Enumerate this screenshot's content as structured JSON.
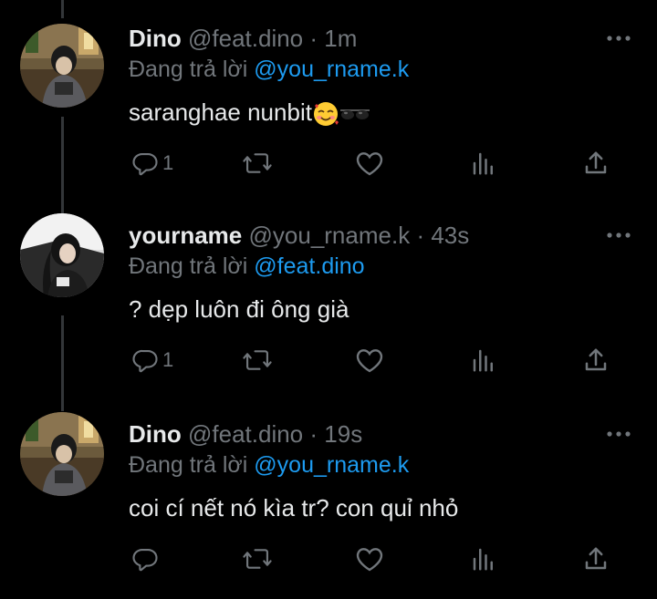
{
  "colors": {
    "background": "#000000",
    "text_primary": "#e7e9ea",
    "text_secondary": "#71767b",
    "link": "#1d9bf0",
    "thread_line": "#333639"
  },
  "tweets": [
    {
      "display_name": "Dino",
      "handle": "@feat.dino",
      "separator": "·",
      "time": "1m",
      "reply_prefix": "Đang trả lời",
      "reply_to": "@you_rname.k",
      "text": "saranghae nunbit",
      "emojis": [
        "smiling-face-with-hearts-emoji",
        "sunglasses-emoji"
      ],
      "reply_count": "1",
      "icons": [
        "reply-icon",
        "retweet-icon",
        "like-icon",
        "views-icon",
        "share-icon",
        "more-icon"
      ]
    },
    {
      "display_name": "yourname",
      "handle": "@you_rname.k",
      "separator": "·",
      "time": "43s",
      "reply_prefix": "Đang trả lời",
      "reply_to": "@feat.dino",
      "text": "? dẹp luôn đi ông già",
      "reply_count": "1",
      "icons": [
        "reply-icon",
        "retweet-icon",
        "like-icon",
        "views-icon",
        "share-icon",
        "more-icon"
      ]
    },
    {
      "display_name": "Dino",
      "handle": "@feat.dino",
      "separator": "·",
      "time": "19s",
      "reply_prefix": "Đang trả lời",
      "reply_to": "@you_rname.k",
      "text": "coi cí nết nó kìa tr? con quỉ nhỏ",
      "reply_count": "",
      "icons": [
        "reply-icon",
        "retweet-icon",
        "like-icon",
        "views-icon",
        "share-icon",
        "more-icon"
      ]
    }
  ]
}
